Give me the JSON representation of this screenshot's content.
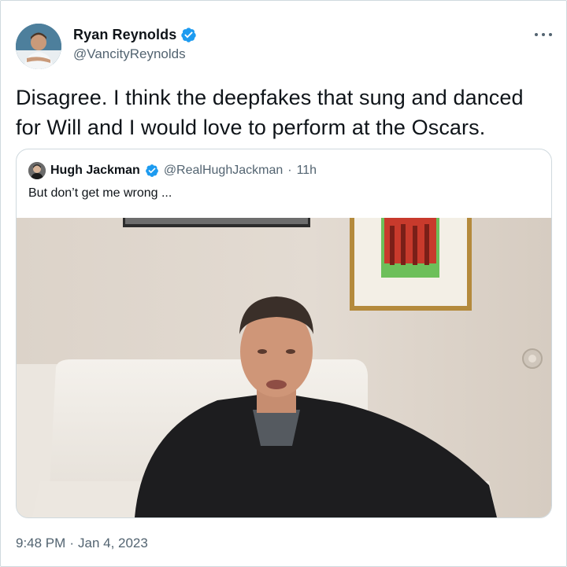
{
  "tweet": {
    "author": {
      "name": "Ryan Reynolds",
      "handle": "@VancityReynolds",
      "avatar_icon": "profile-photo"
    },
    "more_icon": "more-options-icon",
    "text": "Disagree. I think the deepfakes that sung and danced for Will and I would love to perform at the Oscars.",
    "quoted": {
      "name": "Hugh Jackman",
      "handle": "@RealHughJackman",
      "separator": "·",
      "time": "11h",
      "text": "But don’t get me wrong ...",
      "media_icon": "video-thumbnail"
    },
    "time": "9:48 PM",
    "separator": "·",
    "date": "Jan 4, 2023"
  },
  "colors": {
    "text_primary": "#0f1419",
    "text_secondary": "#536471",
    "verified_blue": "#1d9bf0",
    "border": "#cfd9de"
  }
}
